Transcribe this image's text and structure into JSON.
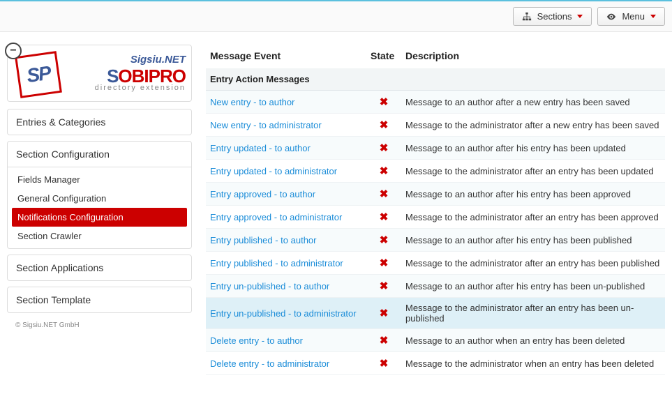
{
  "topbar": {
    "sections_label": "Sections",
    "menu_label": "Menu"
  },
  "logo": {
    "sigsiu": "Sigsiu.NET",
    "brand_prefix": "S",
    "brand_rest": "OBIPRO",
    "sp": "SP",
    "tagline": "directory extension"
  },
  "sidebar": {
    "entries_categories": "Entries & Categories",
    "section_configuration": "Section Configuration",
    "sub": {
      "fields_manager": "Fields Manager",
      "general_configuration": "General Configuration",
      "notifications_configuration": "Notifications Configuration",
      "section_crawler": "Section Crawler"
    },
    "section_applications": "Section Applications",
    "section_template": "Section Template"
  },
  "footer": "© Sigsiu.NET GmbH",
  "table": {
    "headers": {
      "event": "Message Event",
      "state": "State",
      "description": "Description"
    },
    "group_label": "Entry Action Messages",
    "rows": [
      {
        "event": "New entry - to author",
        "desc": "Message to an author after a new entry has been saved",
        "highlight": false
      },
      {
        "event": "New entry - to administrator",
        "desc": "Message to the administrator after a new entry has been saved",
        "highlight": false
      },
      {
        "event": "Entry updated - to author",
        "desc": "Message to an author after his entry has been updated",
        "highlight": false
      },
      {
        "event": "Entry updated - to administrator",
        "desc": "Message to the administrator after an entry has been updated",
        "highlight": false
      },
      {
        "event": "Entry approved - to author",
        "desc": "Message to an author after his entry has been approved",
        "highlight": false
      },
      {
        "event": "Entry approved - to administrator",
        "desc": "Message to the administrator after an entry has been approved",
        "highlight": false
      },
      {
        "event": "Entry published - to author",
        "desc": "Message to an author after his entry has been published",
        "highlight": false
      },
      {
        "event": "Entry published - to administrator",
        "desc": "Message to the administrator after an entry has been published",
        "highlight": false
      },
      {
        "event": "Entry un-published - to author",
        "desc": "Message to an author after his entry has been un-published",
        "highlight": false
      },
      {
        "event": "Entry un-published - to administrator",
        "desc": "Message to the administrator after an entry has been un-published",
        "highlight": true
      },
      {
        "event": "Delete entry - to author",
        "desc": "Message to an author when an entry has been deleted",
        "highlight": false
      },
      {
        "event": "Delete entry - to administrator",
        "desc": "Message to the administrator when an entry has been deleted",
        "highlight": false
      }
    ]
  }
}
